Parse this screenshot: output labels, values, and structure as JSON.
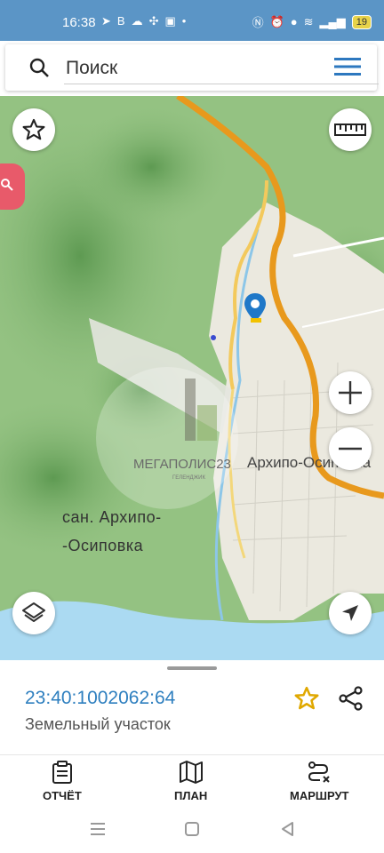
{
  "status_bar": {
    "time": "16:38",
    "battery": "19",
    "left_icons": [
      "telegram-icon",
      "vk-icon",
      "cloud-icon",
      "app-icon",
      "calendar-icon",
      "dot-icon"
    ],
    "right_icons": [
      "nfc-icon",
      "alarm-icon",
      "location-icon",
      "wifi-icon",
      "signal-icon"
    ]
  },
  "search": {
    "placeholder": "Поиск"
  },
  "map": {
    "watermark": "МЕГАПОЛИС23",
    "watermark_sub": "ГЕЛЕНДЖИК",
    "town_label": "Архипо-Осиповка",
    "settlement_label_line1": "сан. Архипо-",
    "settlement_label_line2": "-Осиповка",
    "colors": {
      "forest": "#8fbf7e",
      "road": "#f0a020",
      "sea": "#aadaf2",
      "urban": "#ecebe3",
      "marker": "#1f78c8"
    }
  },
  "parcel": {
    "cadastral_number": "23:40:1002062:64",
    "type": "Земельный участок"
  },
  "bottom_nav": {
    "report": "ОТЧЁТ",
    "plan": "ПЛАН",
    "route": "МАРШРУТ"
  }
}
